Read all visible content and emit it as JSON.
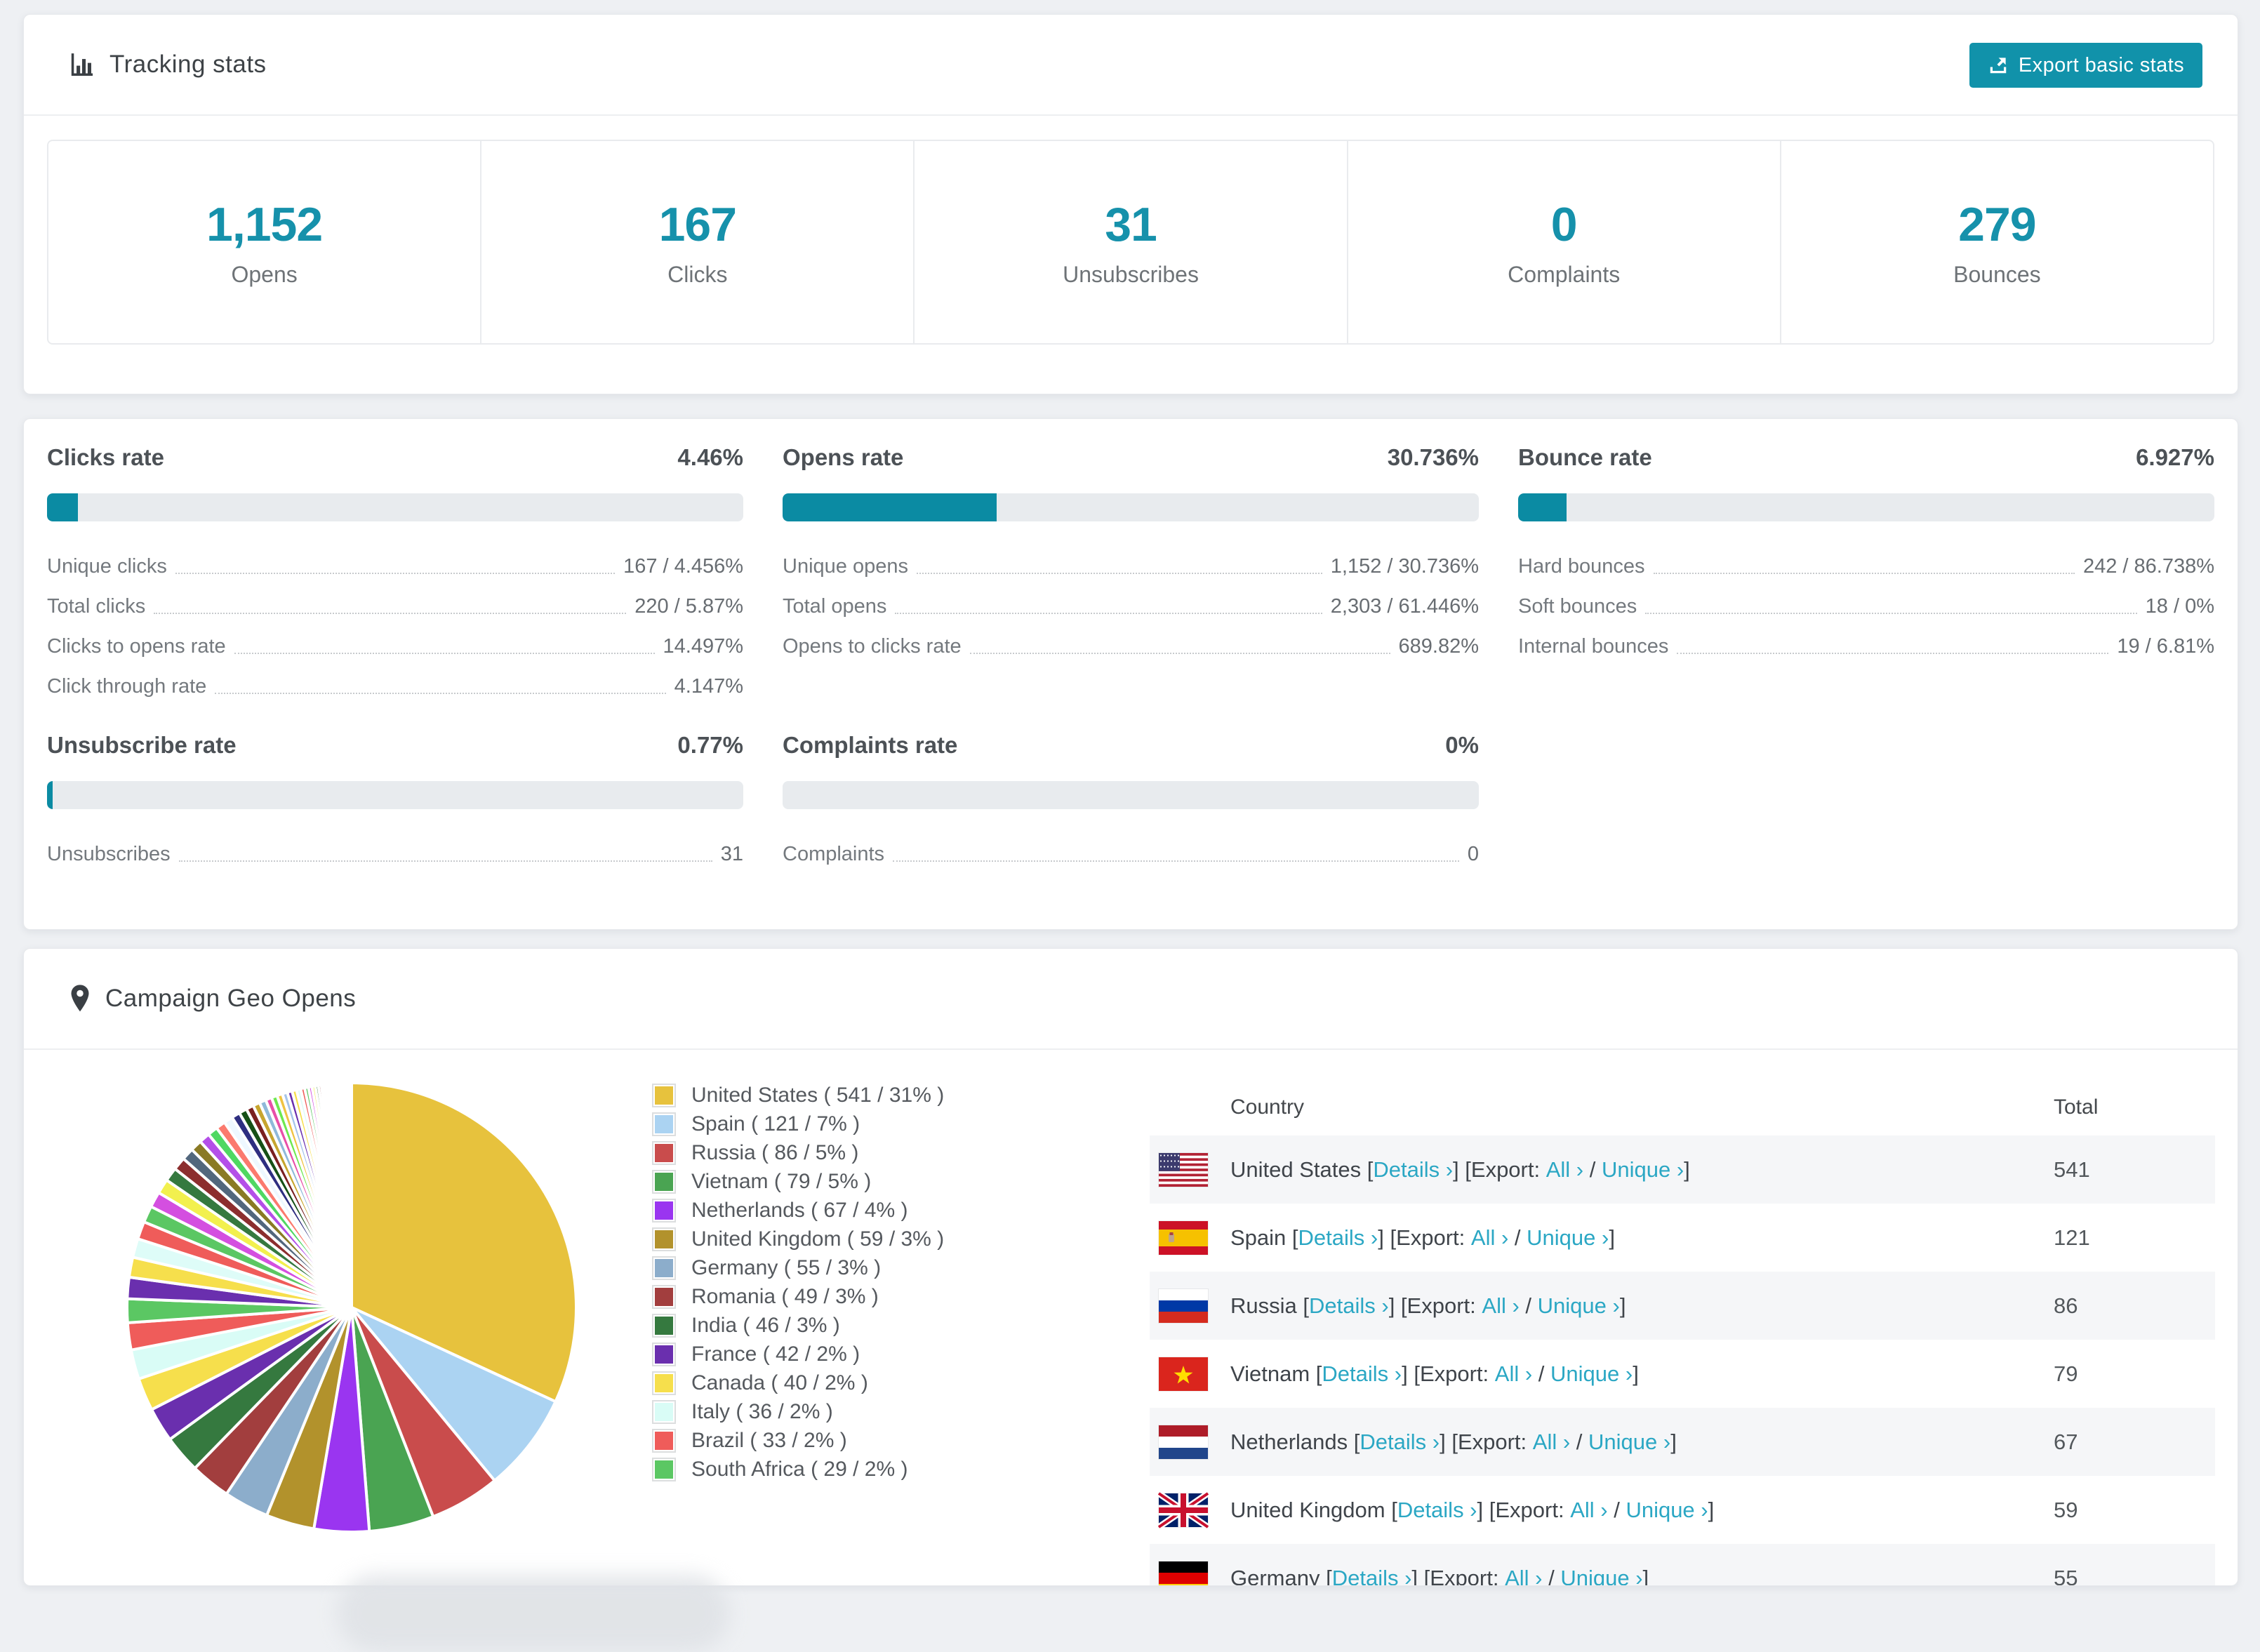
{
  "colors": {
    "accent_teal": "#1192aa",
    "bar_teal": "#0b8ba3",
    "link_teal": "#2ba7c4"
  },
  "tracking": {
    "title": "Tracking stats",
    "export_label": "Export basic stats",
    "summary": [
      {
        "value": "1,152",
        "label": "Opens"
      },
      {
        "value": "167",
        "label": "Clicks"
      },
      {
        "value": "31",
        "label": "Unsubscribes"
      },
      {
        "value": "0",
        "label": "Complaints"
      },
      {
        "value": "279",
        "label": "Bounces"
      }
    ]
  },
  "rates": {
    "top": [
      {
        "title": "Clicks rate",
        "value": "4.46%",
        "percent": 4.46,
        "rows": [
          {
            "label": "Unique clicks",
            "value": "167 / 4.456%"
          },
          {
            "label": "Total clicks",
            "value": "220 / 5.87%"
          },
          {
            "label": "Clicks to opens rate",
            "value": "14.497%"
          },
          {
            "label": "Click through rate",
            "value": "4.147%"
          }
        ]
      },
      {
        "title": "Opens rate",
        "value": "30.736%",
        "percent": 30.736,
        "rows": [
          {
            "label": "Unique opens",
            "value": "1,152 / 30.736%"
          },
          {
            "label": "Total opens",
            "value": "2,303 / 61.446%"
          },
          {
            "label": "Opens to clicks rate",
            "value": "689.82%"
          }
        ]
      },
      {
        "title": "Bounce rate",
        "value": "6.927%",
        "percent": 6.927,
        "rows": [
          {
            "label": "Hard bounces",
            "value": "242 / 86.738%"
          },
          {
            "label": "Soft bounces",
            "value": "18 / 0%"
          },
          {
            "label": "Internal bounces",
            "value": "19 / 6.81%"
          }
        ]
      }
    ],
    "bottom": [
      {
        "title": "Unsubscribe rate",
        "value": "0.77%",
        "percent": 0.77,
        "rows": [
          {
            "label": "Unsubscribes",
            "value": "31"
          }
        ]
      },
      {
        "title": "Complaints rate",
        "value": "0%",
        "percent": 0,
        "rows": [
          {
            "label": "Complaints",
            "value": "0"
          }
        ]
      }
    ]
  },
  "geo": {
    "title": "Campaign Geo Opens",
    "table_headers": {
      "country": "Country",
      "total": "Total"
    },
    "row_labels": {
      "details": "Details",
      "export": "Export:",
      "all": "All",
      "unique": "Unique",
      "chevron": "›"
    },
    "countries": [
      {
        "name": "United States",
        "flag": "us",
        "count": 541,
        "pct": 31,
        "color": "#e7c23d"
      },
      {
        "name": "Spain",
        "flag": "es",
        "count": 121,
        "pct": 7,
        "color": "#abd3f2"
      },
      {
        "name": "Russia",
        "flag": "ru",
        "count": 86,
        "pct": 5,
        "color": "#c94c4c"
      },
      {
        "name": "Vietnam",
        "flag": "vn",
        "count": 79,
        "pct": 5,
        "color": "#4aa452"
      },
      {
        "name": "Netherlands",
        "flag": "nl",
        "count": 67,
        "pct": 4,
        "color": "#9a35f0"
      },
      {
        "name": "United Kingdom",
        "flag": "gb",
        "count": 59,
        "pct": 3,
        "color": "#b2922c"
      },
      {
        "name": "Germany",
        "flag": "de",
        "count": 55,
        "pct": 3,
        "color": "#8cadcb"
      },
      {
        "name": "Romania",
        "flag": "ro",
        "count": 49,
        "pct": 3,
        "color": "#a23e3e"
      },
      {
        "name": "India",
        "flag": "in",
        "count": 46,
        "pct": 3,
        "color": "#35793f"
      },
      {
        "name": "France",
        "flag": "fr",
        "count": 42,
        "pct": 2,
        "color": "#6a2fae"
      },
      {
        "name": "Canada",
        "flag": "ca",
        "count": 40,
        "pct": 2,
        "color": "#f6df4c"
      },
      {
        "name": "Italy",
        "flag": "it",
        "count": 36,
        "pct": 2,
        "color": "#d9fcf6"
      },
      {
        "name": "Brazil",
        "flag": "br",
        "count": 33,
        "pct": 2,
        "color": "#ef5c5a"
      },
      {
        "name": "South Africa",
        "flag": "za",
        "count": 29,
        "pct": 2,
        "color": "#5bc763"
      }
    ],
    "visible_table_rows": 7,
    "chart_data": {
      "type": "pie",
      "title": "Campaign Geo Opens",
      "labels": [
        "United States",
        "Spain",
        "Russia",
        "Vietnam",
        "Netherlands",
        "United Kingdom",
        "Germany",
        "Romania",
        "India",
        "France",
        "Canada",
        "Italy",
        "Brazil",
        "South Africa"
      ],
      "values": [
        541,
        121,
        86,
        79,
        67,
        59,
        55,
        49,
        46,
        42,
        40,
        36,
        33,
        29
      ],
      "percent_labels": [
        31,
        7,
        5,
        5,
        4,
        3,
        3,
        3,
        3,
        2,
        2,
        2,
        2,
        2
      ],
      "colors": [
        "#e7c23d",
        "#abd3f2",
        "#c94c4c",
        "#4aa452",
        "#9a35f0",
        "#b2922c",
        "#8cadcb",
        "#a23e3e",
        "#35793f",
        "#6a2fae",
        "#f6df4c",
        "#d9fcf6",
        "#ef5c5a",
        "#5bc763"
      ],
      "legend_position": "right",
      "start_angle": "top",
      "direction": "clockwise",
      "others_tail": {
        "approx_count": 50,
        "first_value": 26,
        "decay": 0.94
      }
    }
  }
}
